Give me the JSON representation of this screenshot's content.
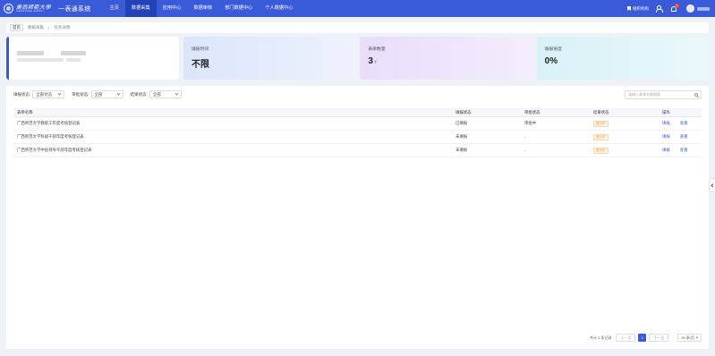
{
  "brand": {
    "logo_cn": "廣西師範大學",
    "logo_en": "GUANGXI NORMAL UNIVERSITY",
    "system_name": "一表通系统"
  },
  "nav": [
    {
      "label": "主页",
      "active": false
    },
    {
      "label": "数据采集",
      "active": true
    },
    {
      "label": "应用中心",
      "active": false
    },
    {
      "label": "数据审核",
      "active": false
    },
    {
      "label": "部门数据中心",
      "active": false
    },
    {
      "label": "个人数据中心",
      "active": false
    }
  ],
  "topright": {
    "org_chart": "组织机构",
    "bell_count": "1",
    "avatar": "avatar-icon"
  },
  "breadcrumb": {
    "home": "首页",
    "sep": "/",
    "level1": "数据采集",
    "level2": "任务详情"
  },
  "cards": {
    "time": {
      "label": "填报时间",
      "value": "不限"
    },
    "count": {
      "label": "表单数量",
      "value": "3",
      "unit": "个"
    },
    "progress": {
      "label": "填报进度",
      "value": "0%"
    }
  },
  "filters": {
    "fill_label": "填报状态:",
    "fill_value": "全部状态",
    "audit_label": "审批状态:",
    "audit_value": "全部",
    "result_label": "结果状态:",
    "result_value": "全部",
    "search_placeholder": "请输入表单名称搜索"
  },
  "table": {
    "headers": {
      "name": "表单名称",
      "fill": "填报状态",
      "audit": "审批状态",
      "result": "结果状态",
      "op": "操作"
    },
    "rows": [
      {
        "name": "广西师范大学教职工年度考核登记表",
        "fill": "已填报",
        "audit": "审批中",
        "result": "进行中",
        "op1": "填报",
        "op2": "查看"
      },
      {
        "name": "广西师范大学科级干部年度考核登记表",
        "fill": "未填报",
        "audit": "-",
        "result": "进行中",
        "op1": "填报",
        "op2": "查看"
      },
      {
        "name": "广西师范大学中层领导干部年度考核登记表",
        "fill": "未填报",
        "audit": "-",
        "result": "进行中",
        "op1": "填报",
        "op2": "查看"
      }
    ]
  },
  "pagination": {
    "total": "共计 3 条记录",
    "prev": "上一页",
    "current": "1",
    "next": "下一页",
    "page_size": "20 条/页"
  },
  "colors": {
    "primary": "#3a5bd9",
    "nav_active": "#2342b8",
    "tag_orange": "#e09a2e",
    "badge_red": "#f04a3e"
  }
}
